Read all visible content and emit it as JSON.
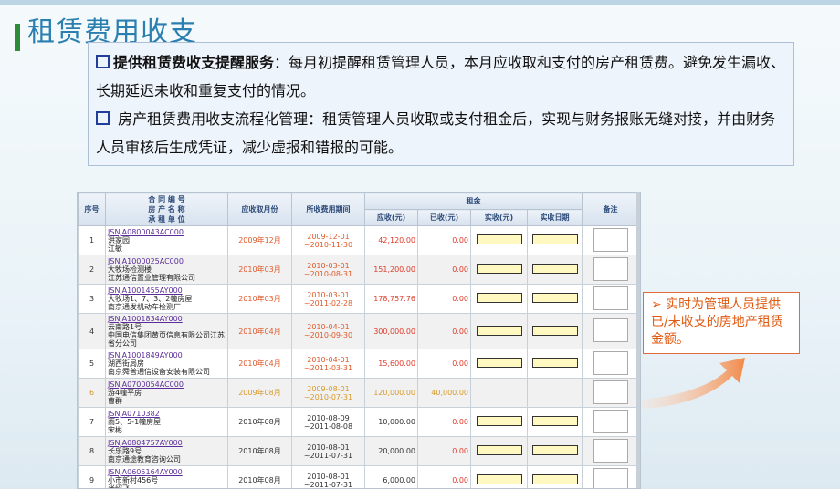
{
  "title": "租赁费用收支",
  "description": {
    "p1_bold": "提供租赁费收支提醒服务",
    "p1_rest": "：每月初提醒租赁管理人员，本月应收取和支付的房产租赁费。避免发生漏收、长期延迟未收和重复支付的情况。",
    "p2": " 房产租赁费用收支流程化管理：租赁管理人员收取或支付租金后，实现与财务报账无缝对接，并由财务人员审核后生成凭证，减少虚报和错报的可能。"
  },
  "table": {
    "headers": {
      "seq": "序号",
      "contract_l1": "合 同 编 号",
      "contract_l2": "房 产 名 称",
      "contract_l3": "承 租 单 位",
      "month": "应收取月份",
      "period": "所收费用期间",
      "rent": "租金",
      "due": "应收(元)",
      "received": "已收(元)",
      "actual": "实收(元)",
      "date": "实收日期",
      "note": "备注"
    },
    "rows": [
      {
        "seq": "1",
        "code": "JSNJA0800043AC000",
        "name": "洪家园",
        "tenant": "江敏",
        "month": "2009年12月",
        "period_from": "2009-12-01",
        "period_to": "~2010-11-30",
        "due": "42,120.00",
        "received": "0.00"
      },
      {
        "seq": "2",
        "code": "JSNJA1000025AC000",
        "name": "大牧场检测楼",
        "tenant": "江苏通信置业管理有限公司",
        "month": "2010年03月",
        "period_from": "2010-03-01",
        "period_to": "~2010-08-31",
        "due": "151,200.00",
        "received": "0.00"
      },
      {
        "seq": "3",
        "code": "JSNJA1001455AY000",
        "name": "大牧场1、7、3、2幢房屋",
        "tenant": "南京通发机动车检测厂",
        "month": "2010年03月",
        "period_from": "2010-03-01",
        "period_to": "~2011-02-28",
        "due": "178,757.76",
        "received": "0.00"
      },
      {
        "seq": "4",
        "code": "JSNJA1001834AY000",
        "name": "云南路1号",
        "tenant": "中国电信集团黄页信息有限公司江苏省分公司",
        "month": "2010年04月",
        "period_from": "2010-04-01",
        "period_to": "~2010-09-30",
        "due": "300,000.00",
        "received": "0.00"
      },
      {
        "seq": "5",
        "code": "JSNJA1001849AY000",
        "name": "湖西街局房",
        "tenant": "南京舜普通信设备安装有限公司",
        "month": "2010年04月",
        "period_from": "2010-04-01",
        "period_to": "~2011-03-31",
        "due": "15,600.00",
        "received": "0.00"
      },
      {
        "seq": "6",
        "code": "JSNJA0700054AC000",
        "name": "游4幢平房",
        "tenant": "曹群",
        "month": "2009年08月",
        "period_from": "2009-08-01",
        "period_to": "~2010-07-31",
        "due": "120,000.00",
        "received": "40,000.00"
      },
      {
        "seq": "7",
        "code": "JSNJA0710382",
        "name": "雨5、5-1幢房屋",
        "tenant": "宋彬",
        "month": "2010年08月",
        "period_from": "2010-08-09",
        "period_to": "~2011-08-08",
        "due": "10,000.00",
        "received": "0.00"
      },
      {
        "seq": "8",
        "code": "JSNJA0804757AY000",
        "name": "长乐路9号",
        "tenant": "南京通途教育咨询公司",
        "month": "2010年08月",
        "period_from": "2010-08-01",
        "period_to": "~2011-07-31",
        "due": "20,000.00",
        "received": "0.00"
      },
      {
        "seq": "9",
        "code": "JSNJA0605164AY000",
        "name": "小市新村456号",
        "tenant": "张绍飞",
        "month": "2010年08月",
        "period_from": "2010-08-01",
        "period_to": "~2011-07-31",
        "due": "6,000.00",
        "received": "0.00"
      }
    ]
  },
  "callout": "➢ 实时为管理人员提供已/未收支的房地产租赁金额。",
  "colors": {
    "title": "#2a7fb0",
    "accent": "#2e8b3a",
    "callout": "#e05a10",
    "highlight_input": "#fff8c0"
  }
}
